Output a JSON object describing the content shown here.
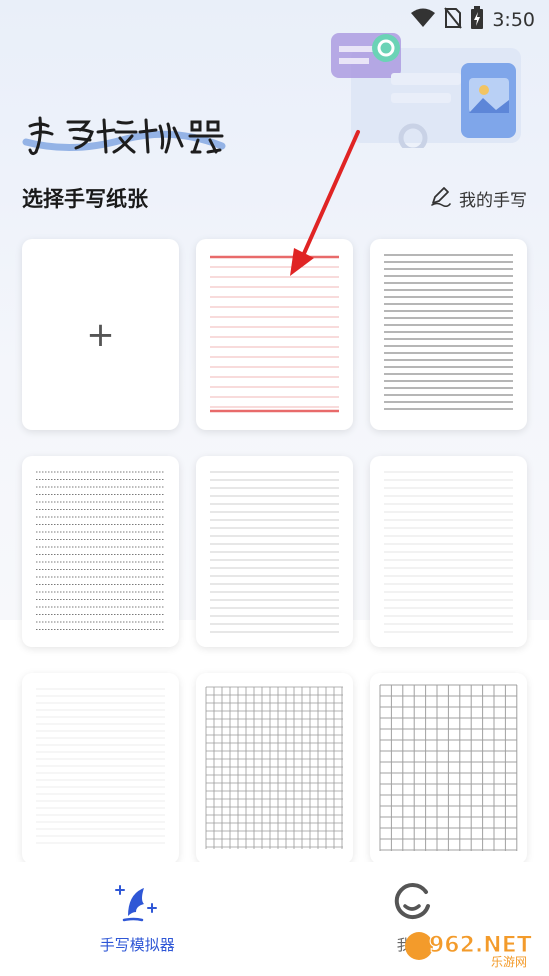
{
  "status": {
    "time": "3:50",
    "icons": [
      "wifi-icon",
      "no-sim-icon",
      "battery-charging-icon"
    ]
  },
  "app": {
    "logo_text": "手写模拟器"
  },
  "header": {
    "title": "选择手写纸张",
    "my_handwriting_label": "我的手写",
    "my_handwriting_icon": "pen-icon"
  },
  "papers": [
    {
      "id": "add",
      "type": "add",
      "symbol": "+"
    },
    {
      "id": "red-lined",
      "type": "red-lined"
    },
    {
      "id": "dark-lined",
      "type": "dark-lined"
    },
    {
      "id": "dotted-lined",
      "type": "dotted-lined"
    },
    {
      "id": "gray-lined",
      "type": "gray-lined"
    },
    {
      "id": "light-lined",
      "type": "light-lined"
    },
    {
      "id": "faint-lined",
      "type": "faint-lined"
    },
    {
      "id": "small-grid",
      "type": "small-grid"
    },
    {
      "id": "large-grid",
      "type": "large-grid"
    }
  ],
  "bottom_nav": {
    "items": [
      {
        "label": "手写模拟器",
        "icon": "quill-sparkle-icon",
        "active": true
      },
      {
        "label": "我的",
        "icon": "smile-icon",
        "active": false
      }
    ]
  },
  "watermark": {
    "text": "962.NET",
    "subtext": "乐游网"
  },
  "colors": {
    "accent": "#2f57d6",
    "annotation_arrow": "#e02424",
    "red_line": "#e86a6a"
  }
}
